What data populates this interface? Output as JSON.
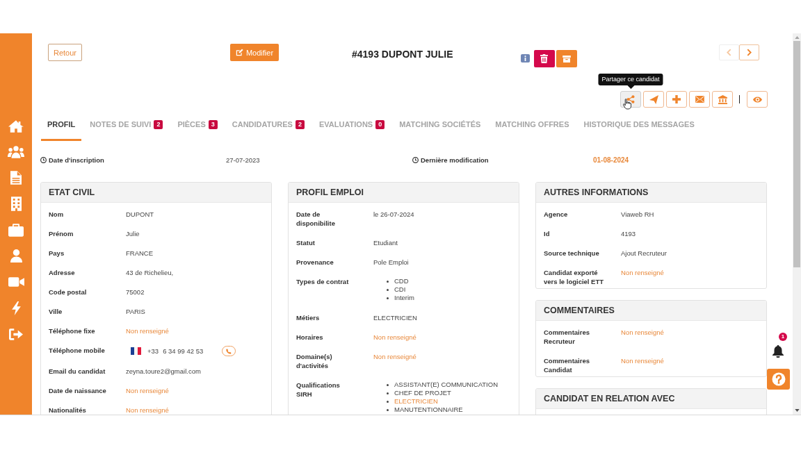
{
  "header": {
    "back_button": "Retour",
    "edit_button": "Modifier",
    "title": "#4193 DUPONT JULIE"
  },
  "pager": [
    {
      "kind": "previous",
      "disabled": true
    },
    {
      "kind": "next",
      "disabled": false
    }
  ],
  "toolbar": {
    "tooltip": "Partager ce candidat",
    "buttons": [
      {
        "kind": "share",
        "hovered": true
      },
      {
        "kind": "send",
        "hovered": false
      },
      {
        "kind": "add",
        "hovered": false
      },
      {
        "kind": "mail",
        "hovered": false
      },
      {
        "kind": "bank",
        "hovered": false
      },
      {
        "kind": "view",
        "hovered": false
      }
    ]
  },
  "tabs": [
    {
      "label": "PROFIL",
      "selected": true
    },
    {
      "label": "NOTES DE SUIVI",
      "badge": "2",
      "selected": false
    },
    {
      "label": "PIÈCES",
      "badge": "3",
      "selected": false
    },
    {
      "label": "CANDIDATURES",
      "badge": "2",
      "selected": false
    },
    {
      "label": "EVALUATIONS",
      "badge": "0",
      "selected": false
    },
    {
      "label": "MATCHING SOCIÉTÉS",
      "selected": false
    },
    {
      "label": "MATCHING OFFRES",
      "selected": false
    },
    {
      "label": "HISTORIQUE DES MESSAGES",
      "selected": false
    }
  ],
  "dates": [
    {
      "label": "Date d'inscription",
      "value": "27-07-2023",
      "highlighted": false
    },
    {
      "label": "Dernière modification",
      "value": "01-08-2024",
      "highlighted": true
    }
  ],
  "columns": [
    [
      {
        "title": "ETAT CIVIL",
        "fields": [
          {
            "kind": "text",
            "label": "Nom",
            "value": "DUPONT",
            "empty": false
          },
          {
            "kind": "text",
            "label": "Prénom",
            "value": "Julie",
            "empty": false
          },
          {
            "kind": "text",
            "label": "Pays",
            "value": "FRANCE",
            "empty": false
          },
          {
            "kind": "text",
            "label": "Adresse",
            "value": "43 de Richelieu,",
            "empty": false
          },
          {
            "kind": "text",
            "label": "Code postal",
            "value": "75002",
            "empty": false
          },
          {
            "kind": "text",
            "label": "Ville",
            "value": "PARIS",
            "empty": false
          },
          {
            "kind": "text",
            "label": "Téléphone fixe",
            "value": "Non renseigné",
            "empty": true
          },
          {
            "kind": "phone",
            "label": "Téléphone mobile",
            "dial_code": "+33",
            "value": "6 34 99 42 53",
            "empty": false
          },
          {
            "kind": "text",
            "label": "Email du candidat",
            "value": "zeyna.toure2@gmail.com",
            "empty": false
          },
          {
            "kind": "text",
            "label": "Date de naissance",
            "value": "Non renseigné",
            "empty": true
          },
          {
            "kind": "text",
            "label": "Nationalités",
            "value": "Non renseigné",
            "empty": true
          }
        ]
      }
    ],
    [
      {
        "title": "PROFIL EMPLOI",
        "fields": [
          {
            "kind": "text",
            "label": "Date de disponibilite",
            "value": "le 26-07-2024",
            "empty": false
          },
          {
            "kind": "text",
            "label": "Statut",
            "value": "Etudiant",
            "empty": false
          },
          {
            "kind": "text",
            "label": "Provenance",
            "value": "Pole Emploi",
            "empty": false
          },
          {
            "kind": "list",
            "label": "Types de contrat",
            "items": [
              {
                "text": "CDD",
                "highlighted": false
              },
              {
                "text": "CDI",
                "highlighted": false
              },
              {
                "text": "Interim",
                "highlighted": false
              }
            ],
            "empty": false
          },
          {
            "kind": "text",
            "label": "Métiers",
            "value": "ELECTRICIEN",
            "empty": false
          },
          {
            "kind": "text",
            "label": "Horaires",
            "value": "Non renseigné",
            "empty": true
          },
          {
            "kind": "text",
            "label": "Domaine(s) d'activités",
            "value": "Non renseigné",
            "empty": true
          },
          {
            "kind": "list",
            "label": "Qualifications SIRH",
            "items": [
              {
                "text": "ASSISTANT(E) COMMUNICATION",
                "highlighted": false
              },
              {
                "text": "CHEF DE PROJET",
                "highlighted": false
              },
              {
                "text": "ELECTRICIEN",
                "highlighted": true
              },
              {
                "text": "MANUTENTIONNAIRE",
                "highlighted": false
              }
            ],
            "empty": false
          }
        ]
      }
    ],
    [
      {
        "title": "AUTRES INFORMATIONS",
        "fields": [
          {
            "kind": "text",
            "label": "Agence",
            "value": "Viaweb RH",
            "empty": false
          },
          {
            "kind": "text",
            "label": "Id",
            "value": "4193",
            "empty": false
          },
          {
            "kind": "text",
            "label": "Source technique",
            "value": "Ajout Recruteur",
            "empty": false
          },
          {
            "kind": "text",
            "label": "Candidat exporté vers le logiciel ETT",
            "value": "Non renseigné",
            "empty": true
          }
        ]
      },
      {
        "title": "COMMENTAIRES",
        "fields": [
          {
            "kind": "text",
            "label": "Commentaires Recruteur",
            "value": "Non renseigné",
            "empty": true
          },
          {
            "kind": "text",
            "label": "Commentaires Candidat",
            "value": "Non renseigné",
            "empty": true
          }
        ]
      },
      {
        "title": "CANDIDAT EN RELATION AVEC"
      }
    ]
  ],
  "notifications": {
    "count": "1"
  }
}
